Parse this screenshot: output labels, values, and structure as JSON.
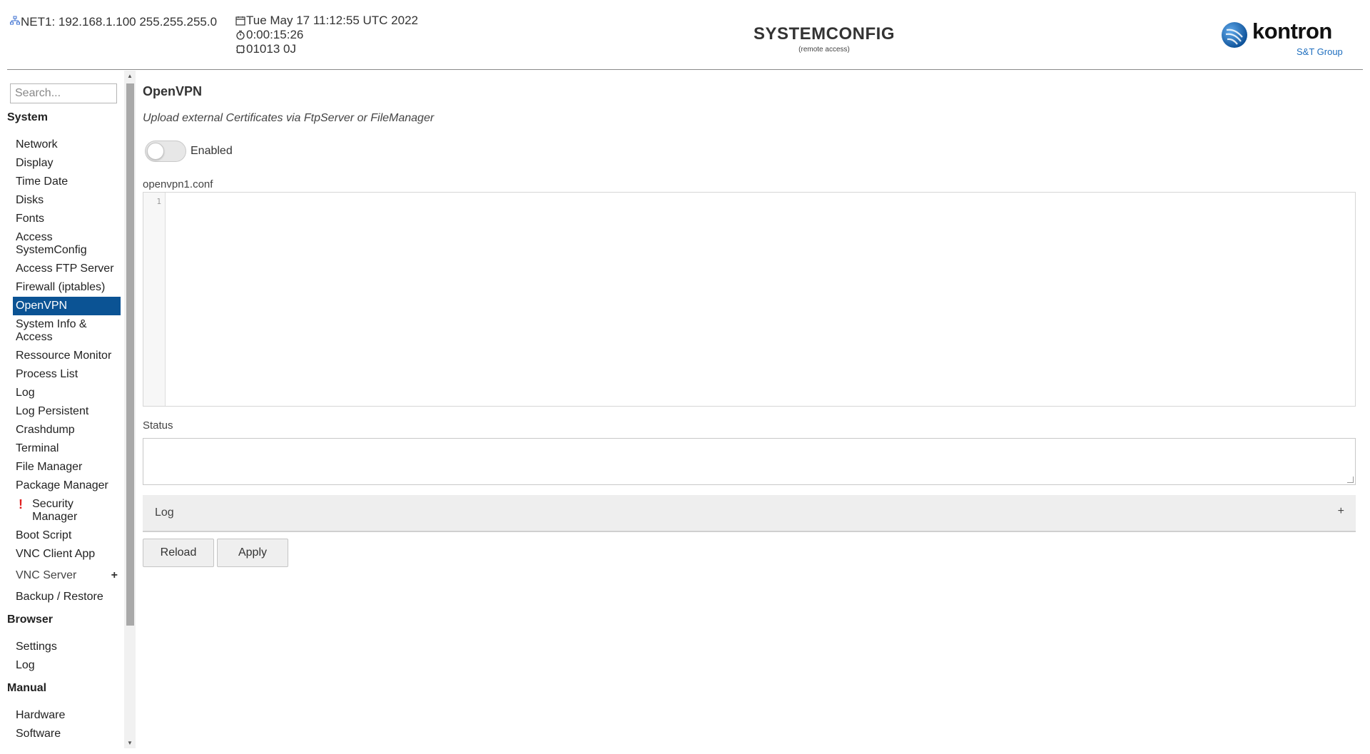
{
  "header": {
    "network": "NET1: 192.168.1.100 255.255.255.0",
    "datetime": "Tue May 17 11:12:55 UTC 2022",
    "uptime": "0:00:15:26",
    "device": "01013 0J",
    "title": "SYSTEMCONFIG",
    "subtitle": "(remote access)",
    "logo_text": "kontron",
    "logo_sub": "S&T Group"
  },
  "sidebar": {
    "search_placeholder": "Search...",
    "sections": [
      {
        "title": "System",
        "items": [
          {
            "label": "Network"
          },
          {
            "label": "Display"
          },
          {
            "label": "Time Date"
          },
          {
            "label": "Disks"
          },
          {
            "label": "Fonts"
          },
          {
            "label": "Access SystemConfig"
          },
          {
            "label": "Access FTP Server"
          },
          {
            "label": "Firewall (iptables)"
          },
          {
            "label": "OpenVPN",
            "active": true
          },
          {
            "label": "System Info & Access"
          },
          {
            "label": "Ressource Monitor"
          },
          {
            "label": "Process List"
          },
          {
            "label": "Log"
          },
          {
            "label": "Log Persistent"
          },
          {
            "label": "Crashdump"
          },
          {
            "label": "Terminal"
          },
          {
            "label": "File Manager"
          },
          {
            "label": "Package Manager"
          },
          {
            "label": "Security Manager",
            "warning": "!"
          },
          {
            "label": "Boot Script"
          },
          {
            "label": "VNC Client App"
          },
          {
            "label": "VNC Server",
            "expander": "+"
          },
          {
            "label": "Backup / Restore"
          }
        ]
      },
      {
        "title": "Browser",
        "items": [
          {
            "label": "Settings"
          },
          {
            "label": "Log"
          }
        ]
      },
      {
        "title": "Manual",
        "items": [
          {
            "label": "Hardware"
          },
          {
            "label": "Software"
          }
        ]
      }
    ]
  },
  "main": {
    "title": "OpenVPN",
    "subtitle": "Upload external Certificates via FtpServer or FileManager",
    "toggle_label": "Enabled",
    "toggle_on": false,
    "config_filename": "openvpn1.conf",
    "editor_line": "1",
    "status_label": "Status",
    "log_label": "Log",
    "log_expander": "+",
    "reload_label": "Reload",
    "apply_label": "Apply"
  },
  "colors": {
    "active_bg": "#0b5394",
    "warning": "#e02020",
    "brand_blue": "#1f6fbf"
  }
}
